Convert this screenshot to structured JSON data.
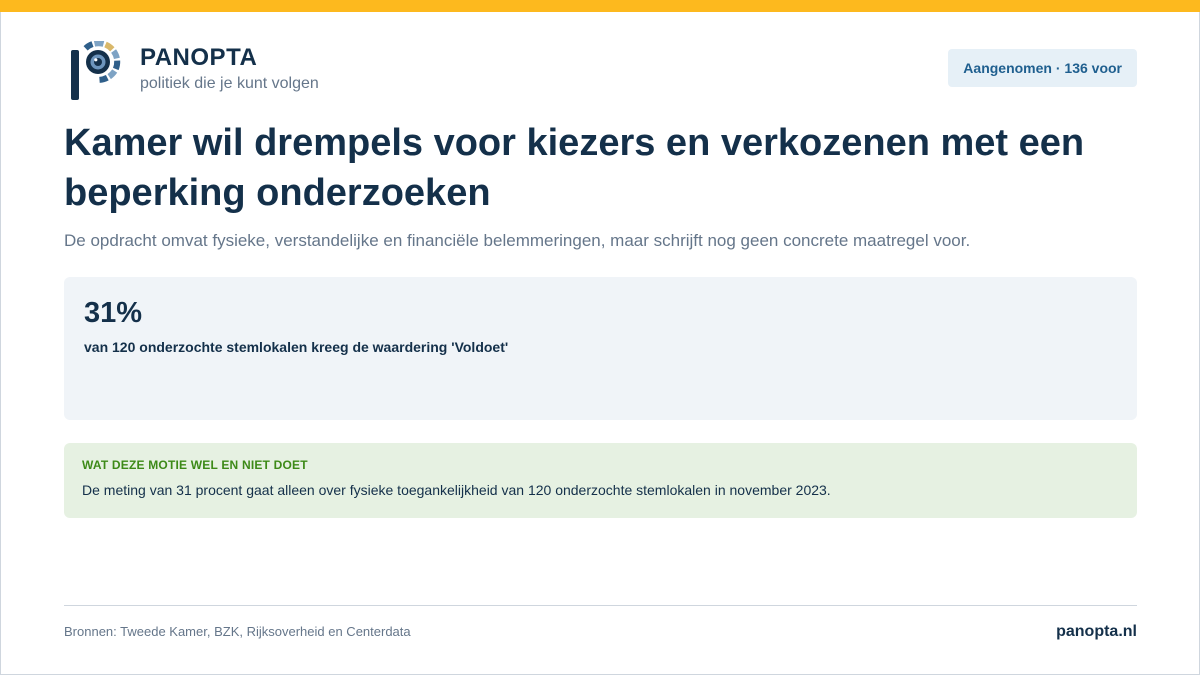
{
  "brand": {
    "name": "PANOPTA",
    "tagline": "politiek die je kunt volgen",
    "logo_icon": "panopta-eye-logo-icon",
    "accent_color": "#fdb91e",
    "primary_color": "#14304a"
  },
  "status_badge": {
    "label": "Aangenomen · 136 voor"
  },
  "article": {
    "headline": "Kamer wil drempels voor kiezers en verkozenen met een beperking onderzoeken",
    "subline": "De opdracht omvat fysieke, verstandelijke en financiële belemmeringen, maar schrijft nog geen concrete maatregel voor."
  },
  "stat": {
    "value": "31%",
    "description": "van 120 onderzochte stemlokalen kreeg de waardering 'Voldoet'"
  },
  "note": {
    "title": "WAT DEZE MOTIE WEL EN NIET DOET",
    "text": "De meting van 31 procent gaat alleen over fysieke toegankelijkheid van 120 onderzochte stemlokalen in november 2023.",
    "accent_color": "#3d8a18"
  },
  "footer": {
    "sources": "Bronnen: Tweede Kamer, BZK, Rijksoverheid en Centerdata",
    "site": "panopta.nl"
  }
}
